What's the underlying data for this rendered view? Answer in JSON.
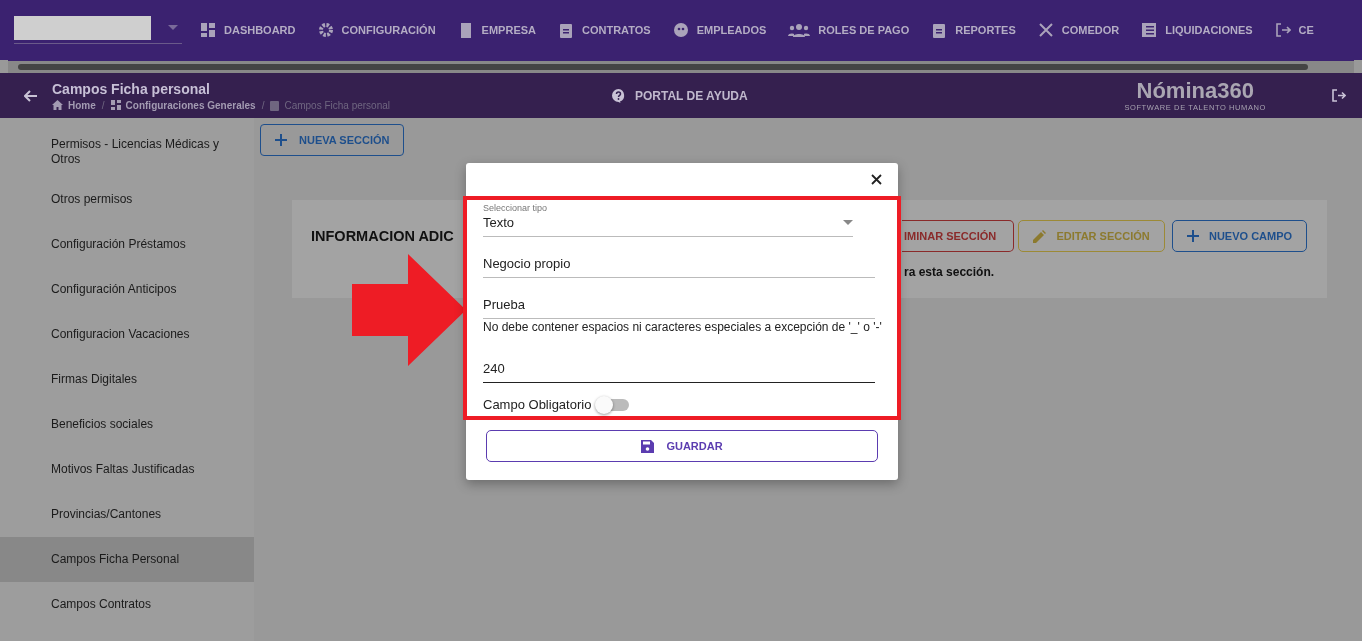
{
  "top_nav": {
    "items": [
      {
        "label": "DASHBOARD"
      },
      {
        "label": "CONFIGURACIÓN"
      },
      {
        "label": "EMPRESA"
      },
      {
        "label": "CONTRATOS"
      },
      {
        "label": "EMPLEADOS"
      },
      {
        "label": "ROLES DE PAGO"
      },
      {
        "label": "REPORTES"
      },
      {
        "label": "COMEDOR"
      },
      {
        "label": "LIQUIDACIONES"
      },
      {
        "label": "CE"
      }
    ]
  },
  "header": {
    "title": "Campos Ficha personal",
    "breadcrumbs": [
      {
        "label": "Home"
      },
      {
        "separator": "/",
        "label": "Configuraciones Generales"
      },
      {
        "separator": "/",
        "label": "Campos Ficha personal"
      }
    ],
    "help_link": "PORTAL DE AYUDA",
    "logo": "Nómina360",
    "tagline": "SOFTWARE DE TALENTO HUMANO"
  },
  "sidebar": {
    "items": [
      {
        "label": "Permisos - Licencias Médicas y Otros",
        "selected": false
      },
      {
        "label": "Otros permisos",
        "selected": false
      },
      {
        "label": "Configuración Préstamos",
        "selected": false
      },
      {
        "label": "Configuración Anticipos",
        "selected": false
      },
      {
        "label": "Configuracion Vacaciones",
        "selected": false
      },
      {
        "label": "Firmas Digitales",
        "selected": false
      },
      {
        "label": "Beneficios sociales",
        "selected": false
      },
      {
        "label": "Motivos Faltas Justificadas",
        "selected": false
      },
      {
        "label": "Provincias/Cantones",
        "selected": false
      },
      {
        "label": "Campos Ficha Personal",
        "selected": true
      },
      {
        "label": "Campos Contratos",
        "selected": false
      }
    ]
  },
  "content": {
    "new_section_button": "NUEVA SECCIÓN",
    "section": {
      "title": "INFORMACION ADIC",
      "buttons": [
        {
          "kind": "delete",
          "label": "IMINAR SECCIÓN"
        },
        {
          "kind": "edit",
          "label": "EDITAR SECCIÓN"
        },
        {
          "kind": "add",
          "label": "NUEVO CAMPO"
        }
      ],
      "note": "ra esta sección."
    }
  },
  "modal": {
    "type_select": {
      "label": "Seleccionar tipo",
      "value": "Texto"
    },
    "fields": [
      {
        "value": "Negocio propio",
        "focused": false
      },
      {
        "value": "Prueba",
        "hint": "No debe contener espacios ni caracteres especiales a excepción de '_' o '-'",
        "focused": false
      },
      {
        "value": "240",
        "focused": true
      }
    ],
    "required_toggle": {
      "label": "Campo Obligatorio",
      "on": false
    },
    "save_button": "GUARDAR"
  }
}
